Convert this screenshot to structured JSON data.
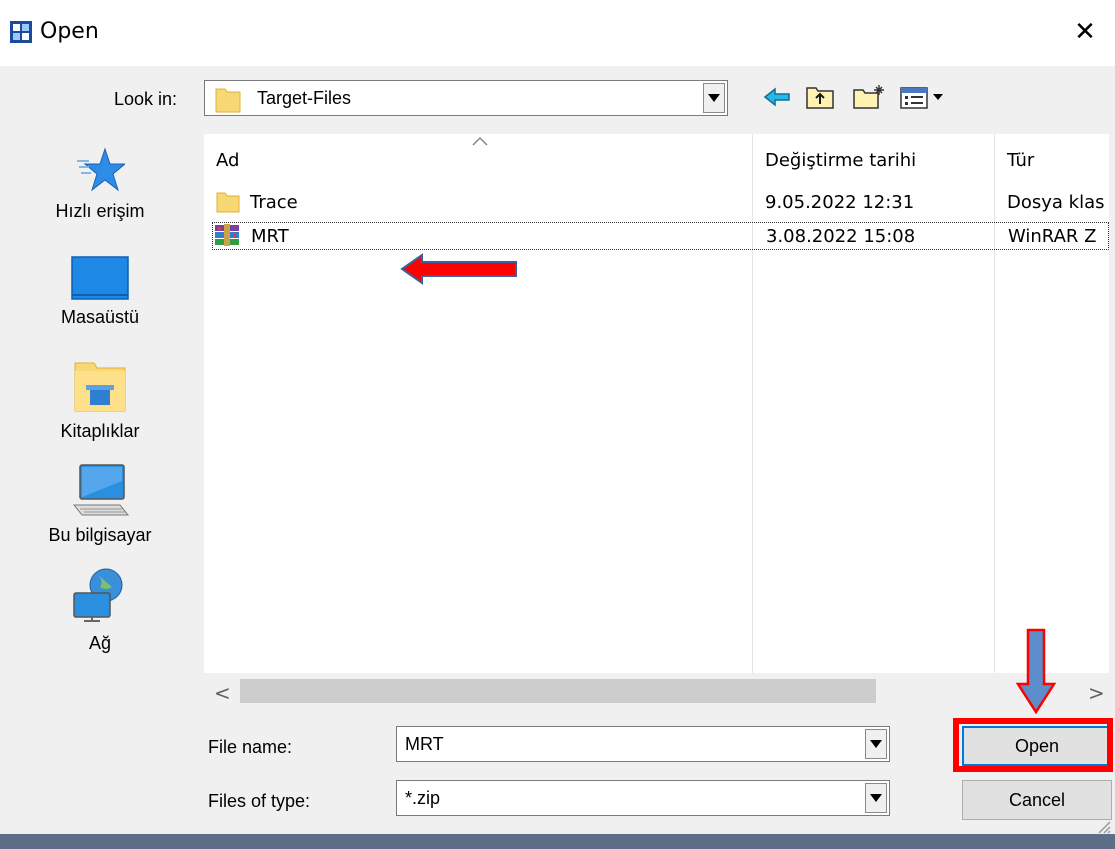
{
  "window": {
    "title": "Open",
    "close_glyph": "✕"
  },
  "toolbar": {
    "look_in_label": "Look in:",
    "look_in_value": "Target-Files",
    "icons": [
      "back-arrow-icon",
      "up-folder-icon",
      "new-folder-icon",
      "view-menu-icon"
    ]
  },
  "places": [
    {
      "label": "Hızlı erişim",
      "icon": "star-icon"
    },
    {
      "label": "Masaüstü",
      "icon": "desktop-icon"
    },
    {
      "label": "Kitaplıklar",
      "icon": "libraries-icon"
    },
    {
      "label": "Bu bilgisayar",
      "icon": "computer-icon"
    },
    {
      "label": "Ağ",
      "icon": "network-icon"
    }
  ],
  "file_list": {
    "columns": [
      "Ad",
      "Değiştirme tarihi",
      "Tür"
    ],
    "rows": [
      {
        "name": "Trace",
        "date": "9.05.2022 12:31",
        "type": "Dosya klas",
        "icon": "folder-icon"
      },
      {
        "name": "MRT",
        "date": "3.08.2022 15:08",
        "type": "WinRAR Z",
        "icon": "winrar-archive-icon",
        "selected": true
      }
    ]
  },
  "scrollbar": {
    "left_glyph": "<",
    "right_glyph": ">"
  },
  "form": {
    "file_name_label": "File name:",
    "file_name_value": "MRT",
    "files_of_type_label": "Files of type:",
    "files_of_type_value": "*.zip"
  },
  "buttons": {
    "open": "Open",
    "cancel": "Cancel"
  },
  "colors": {
    "accent": "#0078d7",
    "annotation_red": "#ff0000",
    "annotation_blue": "#5b8ecb"
  }
}
